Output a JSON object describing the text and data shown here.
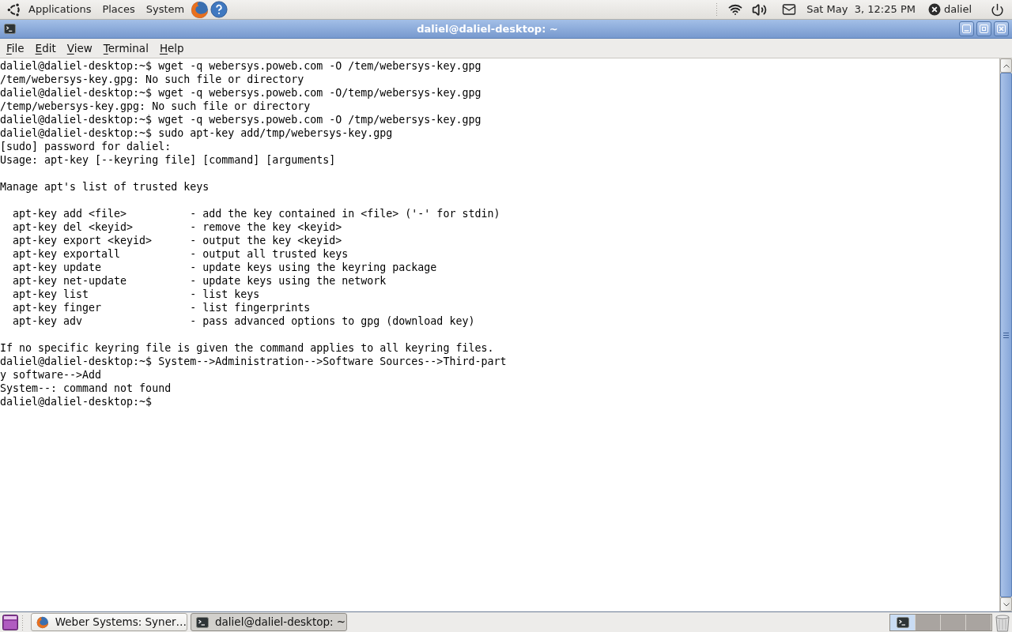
{
  "top_panel": {
    "menus": [
      "Applications",
      "Places",
      "System"
    ],
    "clock": "Sat May  3, 12:25 PM",
    "user": "daliel"
  },
  "window": {
    "title": "daliel@daliel-desktop: ~",
    "menu": [
      "File",
      "Edit",
      "View",
      "Terminal",
      "Help"
    ]
  },
  "terminal": {
    "lines": [
      {
        "kind": "text",
        "text": "daliel@daliel-desktop:~$ wget -q webersys.poweb.com -O /tem/webersys-key.gpg"
      },
      {
        "kind": "text",
        "text": "/tem/webersys-key.gpg: No such file or directory"
      },
      {
        "kind": "text",
        "text": "daliel@daliel-desktop:~$ wget -q webersys.poweb.com -O/temp/webersys-key.gpg"
      },
      {
        "kind": "text",
        "text": "/temp/webersys-key.gpg: No such file or directory"
      },
      {
        "kind": "text",
        "text": "daliel@daliel-desktop:~$ wget -q webersys.poweb.com -O /tmp/webersys-key.gpg"
      },
      {
        "kind": "text",
        "text": "daliel@daliel-desktop:~$ sudo apt-key add/tmp/webersys-key.gpg"
      },
      {
        "kind": "text",
        "text": "[sudo] password for daliel:"
      },
      {
        "kind": "text",
        "text": "Usage: apt-key [--keyring file] [command] [arguments]"
      },
      {
        "kind": "blank"
      },
      {
        "kind": "text",
        "text": "Manage apt's list of trusted keys"
      },
      {
        "kind": "blank"
      },
      {
        "kind": "text",
        "text": "  apt-key add <file>          - add the key contained in <file> ('-' for stdin)"
      },
      {
        "kind": "text",
        "text": "  apt-key del <keyid>         - remove the key <keyid>"
      },
      {
        "kind": "text",
        "text": "  apt-key export <keyid>      - output the key <keyid>"
      },
      {
        "kind": "text",
        "text": "  apt-key exportall           - output all trusted keys"
      },
      {
        "kind": "text",
        "text": "  apt-key update              - update keys using the keyring package"
      },
      {
        "kind": "text",
        "text": "  apt-key net-update          - update keys using the network"
      },
      {
        "kind": "text",
        "text": "  apt-key list                - list keys"
      },
      {
        "kind": "text",
        "text": "  apt-key finger              - list fingerprints"
      },
      {
        "kind": "text",
        "text": "  apt-key adv                 - pass advanced options to gpg (download key)"
      },
      {
        "kind": "blank"
      },
      {
        "kind": "text",
        "text": "If no specific keyring file is given the command applies to all keyring files."
      },
      {
        "kind": "text",
        "text": "daliel@daliel-desktop:~$ System-->Administration-->Software Sources-->Third-part"
      },
      {
        "kind": "text",
        "text": "y software-->Add"
      },
      {
        "kind": "text",
        "text": "System--: command not found"
      },
      {
        "kind": "text",
        "text": "daliel@daliel-desktop:~$"
      }
    ]
  },
  "taskbar": {
    "tasks": [
      {
        "kind": "browser",
        "label": "Weber Systems: Syner…",
        "selected": false
      },
      {
        "kind": "terminal",
        "label": "daliel@daliel-desktop: ~",
        "selected": true
      }
    ],
    "workspaces": [
      {
        "selected": true,
        "has_window": true
      },
      {
        "selected": false,
        "has_window": false
      },
      {
        "selected": false,
        "has_window": false
      },
      {
        "selected": false,
        "has_window": false
      }
    ]
  }
}
